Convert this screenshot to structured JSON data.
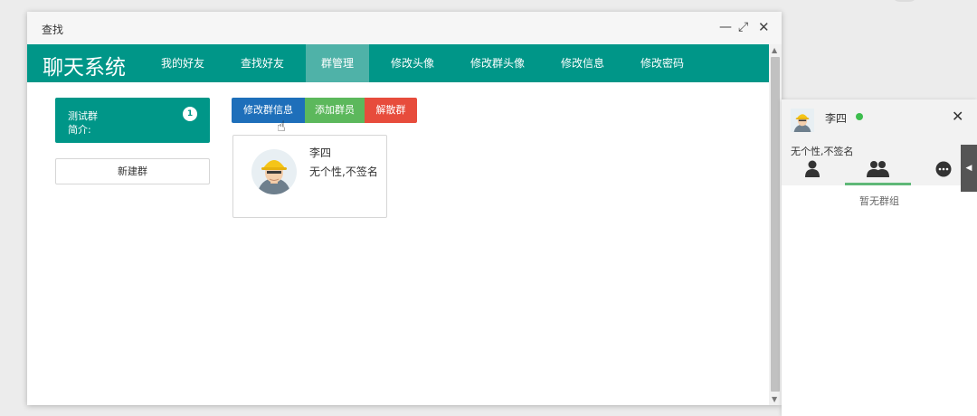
{
  "window": {
    "title": "查找",
    "controls": {
      "minimize": "—",
      "maximize": "⤢",
      "close": "✕"
    }
  },
  "navbar": {
    "brand": "聊天系统",
    "items": [
      {
        "label": "我的好友",
        "active": false
      },
      {
        "label": "查找好友",
        "active": false
      },
      {
        "label": "群管理",
        "active": true
      },
      {
        "label": "修改头像",
        "active": false
      },
      {
        "label": "修改群头像",
        "active": false
      },
      {
        "label": "修改信息",
        "active": false
      },
      {
        "label": "修改密码",
        "active": false
      }
    ]
  },
  "sidebar": {
    "group": {
      "name": "测试群",
      "intro": "简介:",
      "badge": "1"
    },
    "new_group_label": "新建群"
  },
  "toolbar": {
    "edit_label": "修改群信息",
    "add_label": "添加群员",
    "dissolve_label": "解散群"
  },
  "member": {
    "name": "李四",
    "signature": "无个性,不签名",
    "avatar_icon": "construction-worker-avatar"
  },
  "panel": {
    "name": "李四",
    "status": "online",
    "signature": "无个性,不签名",
    "close": "✕",
    "tabs": [
      {
        "icon": "user-icon"
      },
      {
        "icon": "group-icon"
      },
      {
        "icon": "chat-bubble-icon"
      }
    ],
    "active_tab": 1,
    "empty_text": "暂无群组",
    "toggle": "◀"
  },
  "colors": {
    "primary": "#009688",
    "blue": "#1e6fba",
    "green": "#5cb85c",
    "red": "#e74c3c",
    "online": "#3dbd4d"
  }
}
